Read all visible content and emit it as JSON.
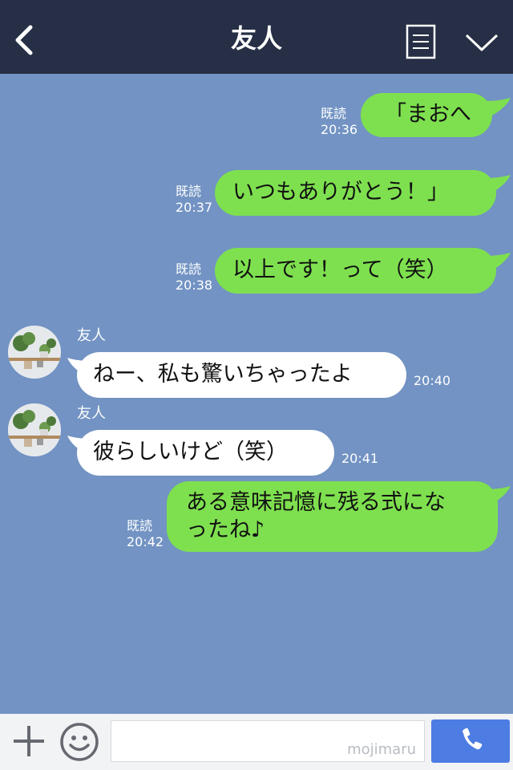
{
  "header": {
    "title": "友人",
    "back_icon": "chevron-left-icon",
    "notes_icon": "notes-icon",
    "menu_icon": "chevron-down-icon",
    "background": "#262f45"
  },
  "chat": {
    "background": "#7293c3",
    "messages": [
      {
        "direction": "out",
        "read_label": "既読",
        "time": "20:36",
        "text": "「まおへ"
      },
      {
        "direction": "out",
        "read_label": "既読",
        "time": "20:37",
        "text": "いつもありがとう！」"
      },
      {
        "direction": "out",
        "read_label": "既読",
        "time": "20:38",
        "text": "以上です！って（笑）"
      },
      {
        "direction": "in",
        "sender": "友人",
        "time": "20:40",
        "text": "ねー、私も驚いちゃったよ"
      },
      {
        "direction": "in",
        "sender": "友人",
        "time": "20:41",
        "text": "彼らしいけど（笑）"
      },
      {
        "direction": "out",
        "read_label": "既読",
        "time": "20:42",
        "text_line1": "ある意味記憶に残る式にな",
        "text_line2": "ったね♪"
      }
    ]
  },
  "footer": {
    "plus_icon": "plus-icon",
    "emoji_icon": "emoji-icon",
    "input_value": "",
    "watermark": "mojimaru",
    "call_icon": "phone-icon",
    "call_color": "#4d7ce3"
  },
  "colors": {
    "outgoing_bubble": "#7ee04f",
    "incoming_bubble": "#ffffff"
  }
}
